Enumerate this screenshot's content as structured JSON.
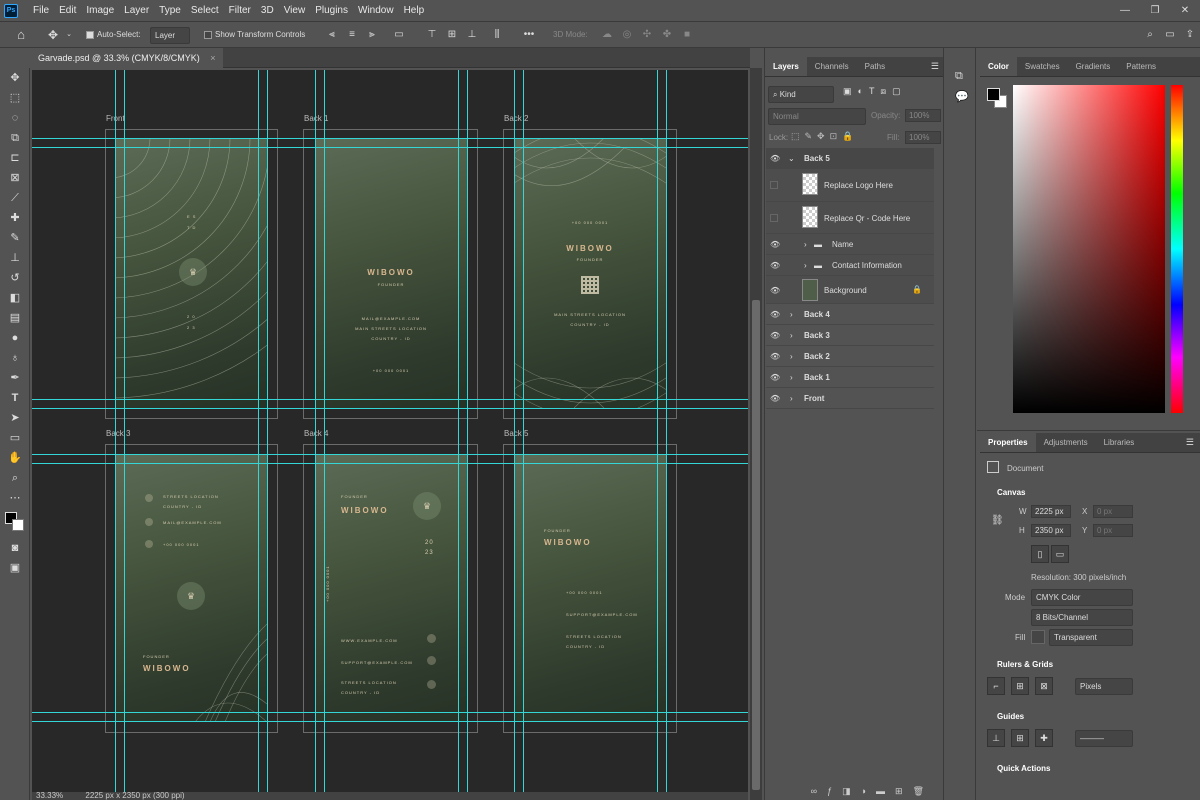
{
  "app": {
    "logo": "Ps"
  },
  "menu": [
    "File",
    "Edit",
    "Image",
    "Layer",
    "Type",
    "Select",
    "Filter",
    "3D",
    "View",
    "Plugins",
    "Window",
    "Help"
  ],
  "window_controls": {
    "minimize": "—",
    "maximize": "❐",
    "close": "✕"
  },
  "options": {
    "auto_select_label": "Auto-Select:",
    "auto_select_value": "Layer",
    "transform_label": "Show Transform Controls",
    "mode_3d": "3D Mode:"
  },
  "document": {
    "tab_title": "Garvade.psd @ 33.3% (CMYK/8/CMYK)",
    "tab_close": "×",
    "status_zoom": "33.33%",
    "status_info": "2225 px x 2350 px (300 ppi)"
  },
  "cards": [
    {
      "label": "Front"
    },
    {
      "label": "Back 1",
      "name": "WIBOWO",
      "title": "FOUNDER",
      "mail": "MAIL@EXAMPLE.COM",
      "street": "MAIN STREETS LOCATION",
      "country": "COUNTRY - ID",
      "phone": "+00 000 0001"
    },
    {
      "label": "Back 2",
      "phone": "+00 000 0001",
      "name": "WIBOWO",
      "title": "FOUNDER",
      "street": "MAIN STREETS LOCATION",
      "country": "COUNTRY - ID"
    },
    {
      "label": "Back 3",
      "street": "STREETS LOCATION",
      "country": "COUNTRY - ID",
      "mail": "MAIL@EXAMPLE.COM",
      "phone": "+00 000 0001",
      "title": "FOUNDER",
      "name": "WIBOWO"
    },
    {
      "label": "Back 4",
      "title": "FOUNDER",
      "name": "WIBOWO",
      "year_a": "20",
      "year_b": "23",
      "phone": "+00 000 0001",
      "web": "WWW.EXAMPLE.COM",
      "support": "SUPPORT@EXAMPLE.COM",
      "street": "STREETS LOCATION",
      "country": "COUNTRY - ID"
    },
    {
      "label": "Back 5",
      "title": "FOUNDER",
      "name": "WIBOWO",
      "phone": "+00 000 0001",
      "support": "SUPPORT@EXAMPLE.COM",
      "street": "STREETS LOCATION",
      "country": "COUNTRY - ID"
    }
  ],
  "front_card": {
    "est_a": "E S",
    "est_b": "T D",
    "year_a": "2 0",
    "year_b": "2 3"
  },
  "layers_panel": {
    "tabs": [
      "Layers",
      "Channels",
      "Paths"
    ],
    "filter_kind": "Kind",
    "blend_mode": "Normal",
    "opacity_label": "Opacity:",
    "opacity_value": "100%",
    "lock_label": "Lock:",
    "fill_label": "Fill:",
    "fill_value": "100%",
    "layers": [
      {
        "name": "Back 5",
        "visible": true,
        "type": "group-open"
      },
      {
        "name": "Replace Logo Here",
        "visible": false,
        "type": "smart"
      },
      {
        "name": "Replace Qr - Code Here",
        "visible": false,
        "type": "smart"
      },
      {
        "name": "Name",
        "visible": true,
        "type": "folder"
      },
      {
        "name": "Contact Information",
        "visible": true,
        "type": "folder"
      },
      {
        "name": "Background",
        "visible": true,
        "type": "background"
      },
      {
        "name": "Back 4",
        "visible": true,
        "type": "group"
      },
      {
        "name": "Back 3",
        "visible": true,
        "type": "group"
      },
      {
        "name": "Back 2",
        "visible": true,
        "type": "group"
      },
      {
        "name": "Back 1",
        "visible": true,
        "type": "group"
      },
      {
        "name": "Front",
        "visible": true,
        "type": "group"
      }
    ]
  },
  "color_panel": {
    "tabs": [
      "Color",
      "Swatches",
      "Gradients",
      "Patterns"
    ]
  },
  "properties_panel": {
    "tabs": [
      "Properties",
      "Adjustments",
      "Libraries"
    ],
    "doc_label": "Document",
    "canvas_title": "Canvas",
    "w_label": "W",
    "w_value": "2225 px",
    "h_label": "H",
    "h_value": "2350 px",
    "x_label": "X",
    "x_value": "0 px",
    "y_label": "Y",
    "y_value": "0 px",
    "resolution": "Resolution: 300 pixels/inch",
    "mode_label": "Mode",
    "mode_value": "CMYK Color",
    "bits_value": "8 Bits/Channel",
    "fill_label": "Fill",
    "fill_value": "Transparent",
    "rulers_title": "Rulers & Grids",
    "units_value": "Pixels",
    "guides_title": "Guides",
    "quick_actions_title": "Quick Actions"
  },
  "colors": {
    "guide": "#35d6d6",
    "accent": "#d8b78f"
  }
}
